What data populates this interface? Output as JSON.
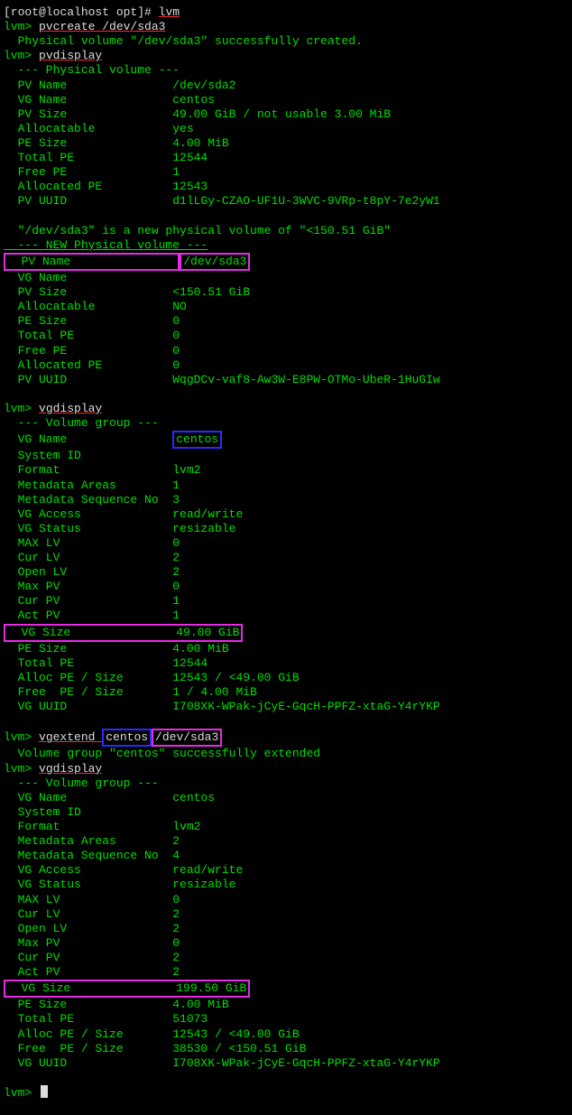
{
  "l0": {
    "prompt": "[root@localhost opt]# ",
    "cmd": "lvm"
  },
  "l1": {
    "prompt": "lvm> ",
    "cmd": "pvcreate /dev/sda3"
  },
  "l2": "  Physical volume \"/dev/sda3\" successfully created.",
  "l3": {
    "prompt": "lvm> ",
    "cmd": "pvdisplay"
  },
  "l4": "  --- Physical volume ---",
  "pv1": {
    "name": "  PV Name               /dev/sda2",
    "vg": "  VG Name               centos",
    "size": "  PV Size               49.00 GiB / not usable 3.00 MiB",
    "alloc": "  Allocatable           yes",
    "pesize": "  PE Size               4.00 MiB",
    "total": "  Total PE              12544",
    "free": "  Free PE               1",
    "allocp": "  Allocated PE          12543",
    "uuid": "  PV UUID               d1lLGy-CZAO-UF1U-3WVC-9VRp-t8pY-7e2yW1"
  },
  "pv2intro": "  \"/dev/sda3\" is a new physical volume of \"<150.51 GiB\"",
  "pv2hdr": "  --- NEW Physical volume ---",
  "pv2": {
    "name_label": "  PV Name               ",
    "name_val": "/dev/sda3",
    "vg": "  VG Name               ",
    "size": "  PV Size               <150.51 GiB",
    "alloc": "  Allocatable           NO",
    "pesize": "  PE Size               0",
    "total": "  Total PE              0",
    "free": "  Free PE               0",
    "allocp": "  Allocated PE          0",
    "uuid": "  PV UUID               WqgDCv-vaf8-Aw3W-E8PW-OTMo-UbeR-1HuGIw"
  },
  "l_vgdisp1": {
    "prompt": "lvm> ",
    "cmd": "vgdisplay"
  },
  "l_vghdr": "  --- Volume group ---",
  "vg1": {
    "name_label": "  VG Name               ",
    "name_val": "centos",
    "sysid": "  System ID             ",
    "format": "  Format                lvm2",
    "meta": "  Metadata Areas        1",
    "metas": "  Metadata Sequence No  3",
    "access": "  VG Access             read/write",
    "status": "  VG Status             resizable",
    "maxlv": "  MAX LV                0",
    "curlv": "  Cur LV                2",
    "openlv": "  Open LV               2",
    "maxpv": "  Max PV                0",
    "curpv": "  Cur PV                1",
    "actpv": "  Act PV                1",
    "vgsize_label": "  VG Size               ",
    "vgsize_val": "49.00 GiB",
    "pesize": "  PE Size               4.00 MiB",
    "totalpe": "  Total PE              12544",
    "allocpe": "  Alloc PE / Size       12543 / <49.00 GiB",
    "freepe": "  Free  PE / Size       1 / 4.00 MiB",
    "uuid": "  VG UUID               I708XK-WPak-jCyE-GqcH-PPFZ-xtaG-Y4rYKP"
  },
  "l_vgextend": {
    "prompt": "lvm> ",
    "cmd_pre": "vgextend ",
    "arg1": "centos",
    "arg2": "/dev/sda3"
  },
  "l_extended": "  Volume group \"centos\" successfully extended",
  "l_vgdisp2": {
    "prompt": "lvm> ",
    "cmd": "vgdisplay"
  },
  "vg2": {
    "name": "  VG Name               centos",
    "sysid": "  System ID             ",
    "format": "  Format                lvm2",
    "meta": "  Metadata Areas        2",
    "metas": "  Metadata Sequence No  4",
    "access": "  VG Access             read/write",
    "status": "  VG Status             resizable",
    "maxlv": "  MAX LV                0",
    "curlv": "  Cur LV                2",
    "openlv": "  Open LV               2",
    "maxpv": "  Max PV                0",
    "curpv": "  Cur PV                2",
    "actpv": "  Act PV                2",
    "vgsize_label": "  VG Size               ",
    "vgsize_val": "199.50 GiB",
    "pesize": "  PE Size               4.00 MiB",
    "totalpe": "  Total PE              51073",
    "allocpe": "  Alloc PE / Size       12543 / <49.00 GiB",
    "freepe": "  Free  PE / Size       38530 / <150.51 GiB",
    "uuid": "  VG UUID               I708XK-WPak-jCyE-GqcH-PPFZ-xtaG-Y4rYKP"
  },
  "l_final": {
    "prompt": "lvm> "
  }
}
